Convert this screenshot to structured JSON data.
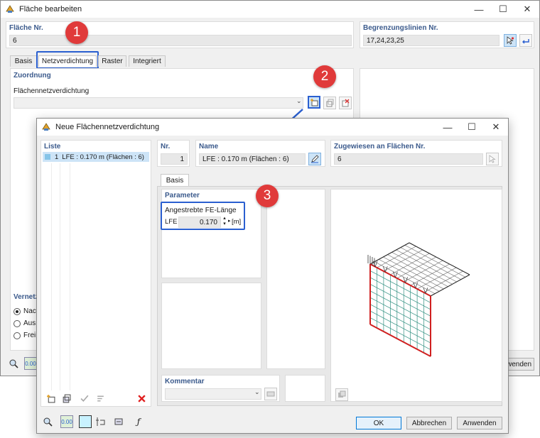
{
  "outer": {
    "title": "Fläche bearbeiten",
    "flaeche_label": "Fläche Nr.",
    "flaeche_value": "6",
    "begrenzung_label": "Begrenzungslinien Nr.",
    "begrenzung_value": "17,24,23,25",
    "tabs": [
      "Basis",
      "Netzverdichtung",
      "Raster",
      "Integriert"
    ],
    "active_tab": "Netzverdichtung",
    "zuordnung_title": "Zuordnung",
    "flaechennetz_label": "Flächennetzverdichtung",
    "vernetz_title": "Vernetz",
    "radio_options": [
      "Nac",
      "Aus",
      "Frei"
    ],
    "radio_selected": 0,
    "anwenden_partial": "wenden",
    "toolbar_value": "0.00"
  },
  "dialog": {
    "title": "Neue Flächennetzverdichtung",
    "liste_title": "Liste",
    "list_items": [
      {
        "nr": "1",
        "text": "LFE : 0.170 m (Flächen : 6)"
      }
    ],
    "nr_label": "Nr.",
    "nr_value": "1",
    "name_label": "Name",
    "name_value": "LFE : 0.170 m (Flächen : 6)",
    "zugewiesen_label": "Zugewiesen an Flächen Nr.",
    "zugewiesen_value": "6",
    "tab_basis": "Basis",
    "parameter_title": "Parameter",
    "angestrebte_label": "Angestrebte FE-Länge",
    "lfe_label": "LFE",
    "lfe_value": "0.170",
    "unit": "[m]",
    "kommentar_title": "Kommentar",
    "toolbar_value": "0.00",
    "btn_ok": "OK",
    "btn_cancel": "Abbrechen",
    "btn_apply": "Anwenden"
  },
  "badges": [
    "1",
    "2",
    "3"
  ],
  "colors": {
    "badge": "#e03a3a",
    "highlight": "#2a5fd0",
    "group_title": "#3b5a8c",
    "mesh_edge": "#d02020",
    "mesh_grid": "#2f8f80"
  }
}
